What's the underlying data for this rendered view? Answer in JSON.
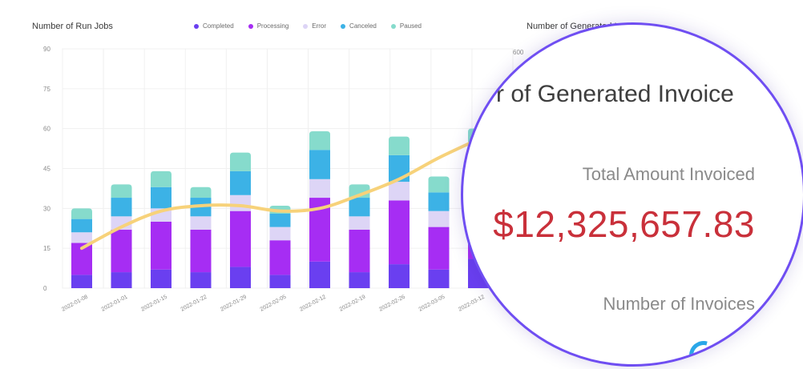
{
  "left_chart": {
    "title": "Number of Run Jobs"
  },
  "right_chart": {
    "title_partial": "Number of Generated Invoice",
    "y_top_tick": "600"
  },
  "magnifier": {
    "title": "r of Generated Invoice",
    "total_label": "Total Amount Invoiced",
    "total_amount": "$12,325,657.83",
    "invoices_label": "Number of Invoices"
  },
  "chart_data": {
    "type": "bar",
    "title": "Number of Run Jobs",
    "stacked": true,
    "categories": [
      "2022-01-08",
      "2022-01-01",
      "2022-01-15",
      "2022-01-22",
      "2022-01-29",
      "2022-02-05",
      "2022-02-12",
      "2022-02-19",
      "2022-02-26",
      "2022-03-05",
      "2022-03-12"
    ],
    "ylim": [
      0,
      90
    ],
    "yticks": [
      0,
      15,
      30,
      45,
      60,
      75,
      90
    ],
    "grid": true,
    "legend_position": "top",
    "series": [
      {
        "name": "Completed",
        "color": "#6a3ff0",
        "values": [
          5,
          6,
          7,
          6,
          8,
          5,
          10,
          6,
          9,
          7,
          11
        ]
      },
      {
        "name": "Processing",
        "color": "#a62df3",
        "values": [
          12,
          16,
          18,
          16,
          21,
          13,
          24,
          16,
          24,
          16,
          24
        ]
      },
      {
        "name": "Error",
        "color": "#ddd5f6",
        "values": [
          4,
          5,
          5,
          5,
          6,
          5,
          7,
          5,
          7,
          6,
          7
        ]
      },
      {
        "name": "Canceled",
        "color": "#3cb2e6",
        "values": [
          5,
          7,
          8,
          7,
          9,
          5,
          11,
          7,
          10,
          7,
          11
        ]
      },
      {
        "name": "Paused",
        "color": "#86dbcc",
        "values": [
          4,
          5,
          6,
          4,
          7,
          3,
          7,
          5,
          7,
          6,
          7
        ]
      }
    ],
    "trend_line": {
      "color": "#f7d27a",
      "values": [
        15,
        23,
        29,
        31,
        31,
        29,
        30,
        35,
        41,
        49,
        56
      ]
    }
  }
}
